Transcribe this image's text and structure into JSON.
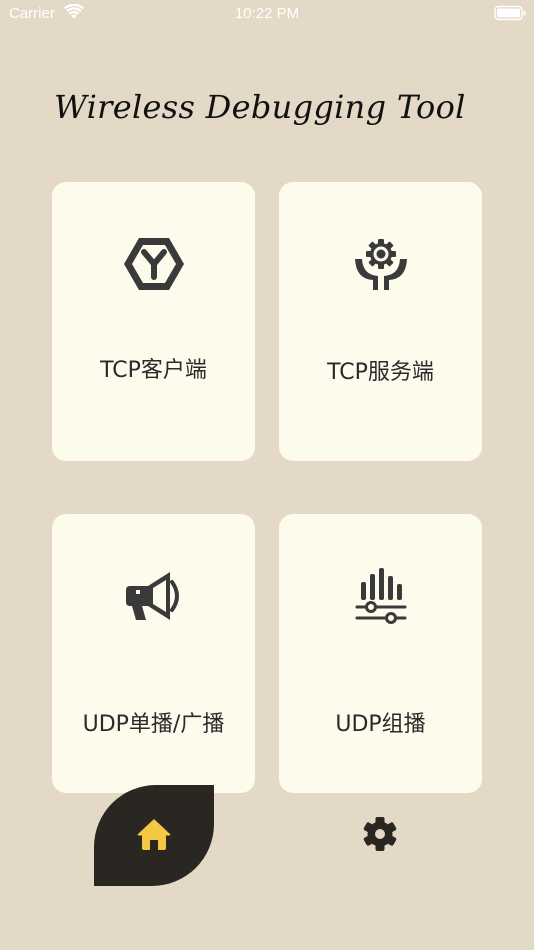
{
  "status_bar": {
    "carrier": "Carrier",
    "time": "10:22 PM"
  },
  "app": {
    "title": "Wireless Debugging Tool"
  },
  "cards": [
    {
      "label": "TCP客户端",
      "icon": "hexagon-y-icon"
    },
    {
      "label": "TCP服务端",
      "icon": "gear-hands-icon"
    },
    {
      "label": "UDP单播/广播",
      "icon": "megaphone-icon"
    },
    {
      "label": "UDP组播",
      "icon": "equalizer-sliders-icon"
    }
  ],
  "tab_bar": {
    "items": [
      {
        "icon": "home-icon",
        "selected": true
      },
      {
        "icon": "gear-icon",
        "selected": false
      }
    ]
  },
  "colors": {
    "background": "#e3d9c6",
    "card": "#fdfbec",
    "tab_active_bg": "#2a2723",
    "home_icon": "#f5c842",
    "icon_dark": "#3a3a3a"
  }
}
